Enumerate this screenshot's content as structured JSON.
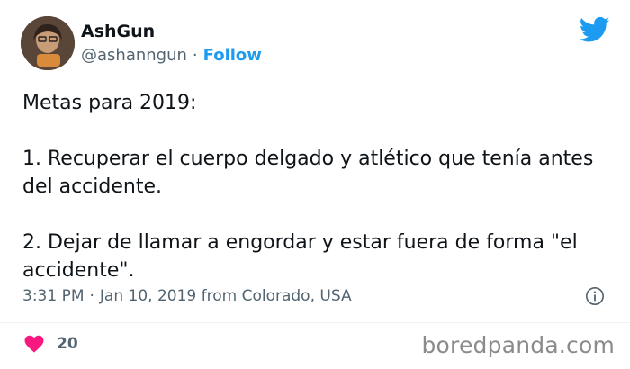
{
  "author": {
    "display_name": "AshGun",
    "handle": "@ashanngun",
    "separator": "·",
    "follow_label": "Follow"
  },
  "tweet": {
    "paragraphs": [
      "Metas para 2019:",
      "1. Recuperar el cuerpo delgado y atlético que tenía antes del accidente.",
      "2. Dejar de llamar a engordar y estar fuera de forma \"el accidente\"."
    ]
  },
  "meta": {
    "time": "3:31 PM",
    "separator": "·",
    "date": "Jan 10, 2019",
    "location": "from Colorado, USA"
  },
  "engagement": {
    "likes": "20"
  },
  "watermark": "boredpanda.com",
  "colors": {
    "accent": "#1d9bf0",
    "like": "#f91880",
    "secondary_text": "#536471"
  },
  "icons": {
    "brand": "twitter-bird-icon",
    "info": "info-icon",
    "like": "heart-icon"
  }
}
